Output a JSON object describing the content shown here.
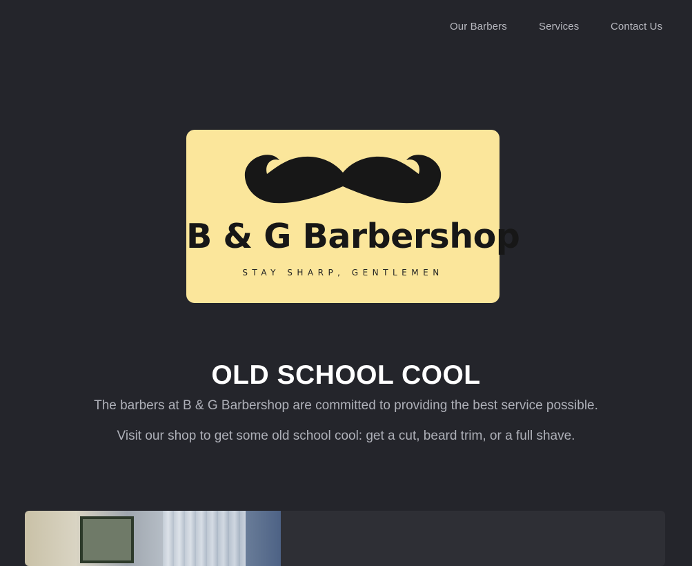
{
  "nav": {
    "items": [
      {
        "label": "Our Barbers"
      },
      {
        "label": "Services"
      },
      {
        "label": "Contact Us"
      }
    ]
  },
  "logo": {
    "brand": "B & G Barbershop",
    "tagline": "STAY SHARP, GENTLEMEN",
    "background_color": "#fbe69b",
    "icon": "mustache-icon"
  },
  "hero": {
    "headline": "OLD SCHOOL COOL",
    "paragraph_1": "The barbers at B & G Barbershop are committed to providing the best service possible.",
    "paragraph_2": "Visit our shop to get some old school cool: get a cut, beard trim, or a full shave."
  },
  "colors": {
    "page_background": "#24252b",
    "card_background": "#2e2f35",
    "nav_text": "#b7b8bf",
    "headline_text": "#ffffff",
    "body_text": "#aeb0b8"
  }
}
